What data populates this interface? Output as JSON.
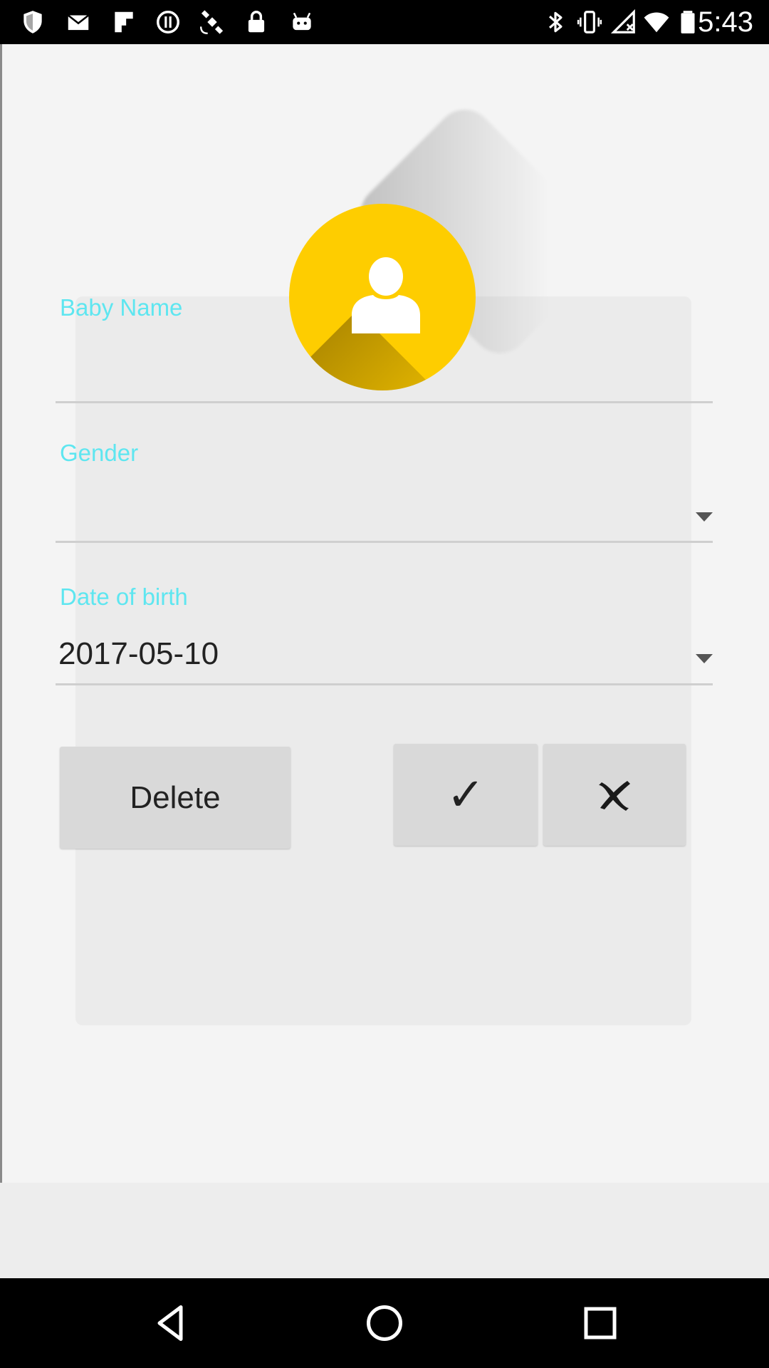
{
  "status_bar": {
    "time": "5:43",
    "left_icons": [
      "shield-icon",
      "mail-icon",
      "flipboard-icon",
      "circle-icon",
      "satellite-icon",
      "lock-icon",
      "android-icon"
    ],
    "right_icons": [
      "bluetooth-icon",
      "vibrate-icon",
      "no-signal-icon",
      "wifi-icon",
      "battery-icon"
    ]
  },
  "form": {
    "baby_name": {
      "label": "Baby Name",
      "value": ""
    },
    "gender": {
      "label": "Gender",
      "value": ""
    },
    "date_of_birth": {
      "label": "Date of birth",
      "value": "2017-05-10"
    }
  },
  "buttons": {
    "delete_label": "Delete",
    "confirm_symbol": "✓",
    "cancel_icon": "close-icon"
  },
  "colors": {
    "accent_label": "#5ee6f0",
    "avatar": "#fecd00"
  },
  "nav_bar": {
    "icons": [
      "back-icon",
      "home-icon",
      "recents-icon"
    ]
  }
}
